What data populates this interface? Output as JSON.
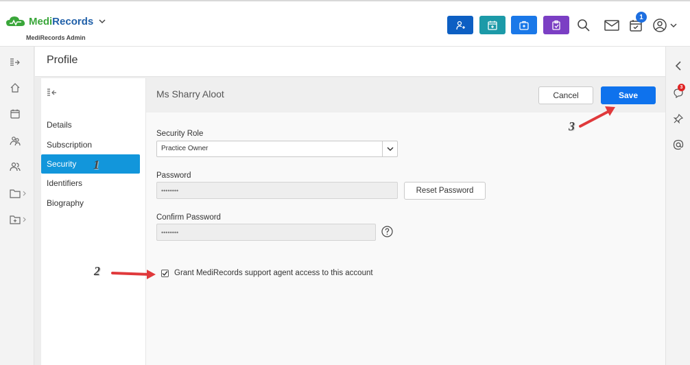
{
  "app": {
    "brand_part1": "Medi",
    "brand_part2": "Records",
    "subtitle": "MediRecords Admin",
    "logo_icon": "cloud-logo-icon"
  },
  "topbar": {
    "quick_buttons": [
      {
        "icon": "add-patient-icon",
        "color": "#0d5fc3"
      },
      {
        "icon": "calendar-add-icon",
        "color": "#1c9aa8"
      },
      {
        "icon": "medical-case-icon",
        "color": "#1a78e8"
      },
      {
        "icon": "clipboard-icon",
        "color": "#7b3fc4"
      }
    ],
    "icons": [
      "search-icon",
      "mail-icon",
      "tasks-icon",
      "user-icon"
    ],
    "tasks_badge": "1"
  },
  "left_nav": [
    "expand-icon",
    "home-icon",
    "calendar-icon",
    "patients-icon",
    "contacts-icon",
    "folder-icon",
    "folder-add-icon"
  ],
  "right_bar": {
    "icons": [
      "chevron-left-icon",
      "chat-icon",
      "pin-icon",
      "at-icon"
    ],
    "chat_badge": "3"
  },
  "page": {
    "title": "Profile"
  },
  "sidenav": {
    "items": [
      {
        "label": "Details"
      },
      {
        "label": "Subscription"
      },
      {
        "label": "Security"
      },
      {
        "label": "Identifiers"
      },
      {
        "label": "Biography"
      }
    ],
    "active": "Security"
  },
  "content": {
    "title": "Ms Sharry Aloot",
    "cancel_label": "Cancel",
    "save_label": "Save",
    "security_role_label": "Security Role",
    "security_role_value": "Practice Owner",
    "password_label": "Password",
    "password_value": "••••••••",
    "reset_password_label": "Reset Password",
    "confirm_password_label": "Confirm Password",
    "confirm_password_value": "••••••••",
    "grant_label": "Grant MediRecords support agent access to this account",
    "grant_checked": true
  },
  "annotations": {
    "n1": "1",
    "n2": "2",
    "n3": "3",
    "arrow_color": "#e0393b"
  },
  "colors": {
    "accent": "#0e72ed",
    "active_nav": "#1296db"
  }
}
